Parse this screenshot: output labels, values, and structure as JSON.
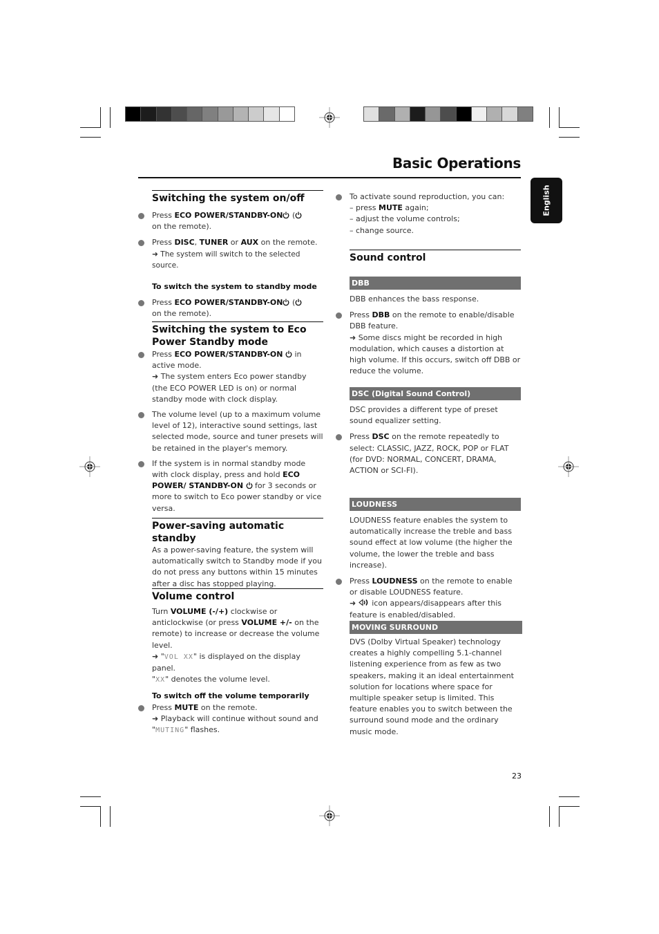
{
  "header": {
    "title": "Basic Operations",
    "language_tab": "English",
    "color_bar_left": [
      "#000000",
      "#1c1c1c",
      "#333333",
      "#4d4d4d",
      "#666666",
      "#808080",
      "#999999",
      "#b3b3b3",
      "#cccccc",
      "#e6e6e6",
      "#ffffff"
    ],
    "color_bar_right": [
      "#e0e0e0",
      "#6a6a6a",
      "#b0b0b0",
      "#1c1c1c",
      "#969696",
      "#4d4d4d",
      "#000000",
      "#f0f0f0",
      "#b0b0b0",
      "#d8d8d8",
      "#808080"
    ]
  },
  "left_column": {
    "s1": {
      "heading": "Switching the system on/off",
      "b1_pre": "Press ",
      "b1_bold": "ECO POWER/STANDBY-ON",
      "b1_post": " (",
      "b1_post2": " on the remote).",
      "b2_pre": "Press ",
      "b2_bold1": "DISC",
      "b2_sep": ", ",
      "b2_bold2": "TUNER",
      "b2_or": " or ",
      "b2_bold3": "AUX",
      "b2_post": " on the remote.",
      "b2_arrow": "➜ The system will switch to the selected source.",
      "sub": "To switch the system to standby mode",
      "b3_pre": "Press ",
      "b3_bold": "ECO POWER/STANDBY-ON",
      "b3_post": " (",
      "b3_post2": " on the remote)."
    },
    "s2": {
      "heading": "Switching the system to Eco Power Standby mode",
      "b1_pre": "Press ",
      "b1_bold": "ECO POWER/STANDBY-ON",
      "b1_post": " in active mode.",
      "b1_arrow": "➜ The system enters Eco power standby (the ECO POWER LED is on) or normal standby mode with clock display.",
      "b2": "The volume level (up to a maximum volume level of 12), interactive sound settings, last selected mode, source and tuner presets will be retained in the player's memory.",
      "b3_pre": "If the system is in normal standby mode with clock display, press and hold ",
      "b3_bold": "ECO POWER/ STANDBY-ON",
      "b3_post": " for 3 seconds or more to switch to Eco power standby or vice versa."
    },
    "s3": {
      "heading": "Power-saving automatic standby",
      "body": "As a power-saving feature, the system will automatically switch to Standby mode if you do not press any buttons within 15 minutes after a disc has stopped playing."
    },
    "s4": {
      "heading": "Volume control",
      "p_pre": "Turn ",
      "p_bold1": "VOLUME (-/+)",
      "p_mid": " clockwise or anticlockwise (or press ",
      "p_bold2": "VOLUME +/-",
      "p_post": " on the remote) to increase or decrease the volume level.",
      "arrow_pre": "➜ \"",
      "lcd1": "VOL XX",
      "arrow_post": "\" is displayed on the display panel.",
      "lcd2": "XX",
      "denote": "\" denotes the volume level.",
      "sub": "To switch off the volume temporarily",
      "b1_pre": "Press ",
      "b1_bold": "MUTE",
      "b1_post": " on the remote.",
      "b1_arrow": "➜ Playback will continue without sound and",
      "lcd3": "MUTING",
      "flashes": "\" flashes."
    }
  },
  "right_column": {
    "activate": {
      "lead": "To activate sound reproduction, you can:",
      "d1_pre": "– press ",
      "d1_bold": "MUTE",
      "d1_post": " again;",
      "d2": "– adjust the volume  controls;",
      "d3": "– change source."
    },
    "sound_heading": "Sound control",
    "dbb": {
      "band": "DBB",
      "intro": "DBB enhances the bass response.",
      "b_pre": "Press ",
      "b_bold": "DBB",
      "b_post": " on the remote to enable/disable DBB feature.",
      "arrow": "➜ Some discs might be recorded in high modulation, which causes a distortion at high volume. If this occurs, switch off DBB or reduce the volume."
    },
    "dsc": {
      "band": "DSC (Digital Sound Control)",
      "intro": "DSC provides a different type of preset sound equalizer setting.",
      "b_pre": "Press ",
      "b_bold": "DSC",
      "b_post": " on the remote repeatedly to select: CLASSIC, JAZZ, ROCK, POP or FLAT (for DVD: NORMAL, CONCERT, DRAMA, ACTION or SCI-FI)."
    },
    "loudness": {
      "band": "LOUDNESS",
      "intro": "LOUDNESS feature enables the system to automatically increase the treble and bass sound effect at low volume (the higher the volume, the lower the treble and bass increase).",
      "b_pre": "Press ",
      "b_bold": "LOUDNESS",
      "b_post": " on the remote to enable or disable LOUDNESS feature.",
      "arrow_pre": "➜ ",
      "arrow_post": " icon appears/disappears after this feature is enabled/disabled."
    },
    "surround": {
      "band": "MOVING SURROUND",
      "body": "DVS (Dolby Virtual Speaker) technology creates a highly compelling 5.1-channel listening experience from as few as two speakers, making it an ideal entertainment solution for locations where space for multiple speaker setup is limited. This feature enables you to switch between the surround sound mode and the ordinary music mode."
    }
  },
  "footer": {
    "page_number": "23"
  }
}
